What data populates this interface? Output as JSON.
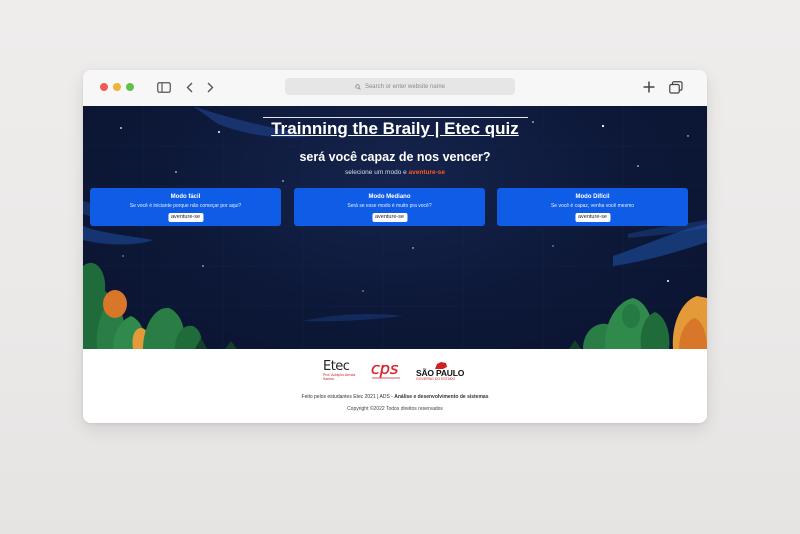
{
  "browser": {
    "address_placeholder": "Search or enter website name"
  },
  "hero": {
    "title": "Trainning the Braily | Etec quiz",
    "subtitle": "será você capaz de nos vencer?",
    "select_prefix": "selecione um modo e ",
    "select_accent": "aventure-se"
  },
  "modes": [
    {
      "title": "Modo fácil",
      "desc": "Se você é iniciante porque não começar por aqui?",
      "button": "aventure-se"
    },
    {
      "title": "Modo Mediano",
      "desc": "Será se esse modo é muito pra você?",
      "button": "aventure-se"
    },
    {
      "title": "Modo Difícil",
      "desc": "Se você é capaz, venha você mesmo",
      "button": "aventure-se"
    }
  ],
  "footer": {
    "logo_etec": "Etec",
    "logo_etec_tagline": "Prof. Adolpho Arruda Santos",
    "logo_cps": "cps",
    "logo_sp": "SÃO PAULO",
    "logo_sp_tagline": "GOVERNO DO ESTADO",
    "credit_a": "Feito pelos estudantes Etec 2021 | ADS -",
    "credit_b": "Análise e desenvolvimento de sistemas",
    "copyright": "Copyright ©2022 Todos direitos reservados"
  },
  "colors": {
    "accent": "#ff5722",
    "card": "#0f5de6",
    "hero_bg": "#0d1838"
  }
}
